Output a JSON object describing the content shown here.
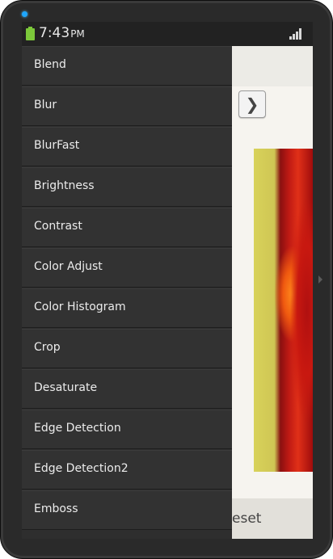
{
  "status_bar": {
    "time": "7:43",
    "ampm": "PM",
    "battery_icon": "battery-icon",
    "signal_icon": "signal-icon",
    "battery_color": "#7cc83a"
  },
  "drawer": {
    "items": [
      {
        "label": "Blend"
      },
      {
        "label": "Blur"
      },
      {
        "label": "BlurFast"
      },
      {
        "label": "Brightness"
      },
      {
        "label": "Contrast"
      },
      {
        "label": "Color Adjust"
      },
      {
        "label": "Color Histogram"
      },
      {
        "label": "Crop"
      },
      {
        "label": "Desaturate"
      },
      {
        "label": "Edge Detection"
      },
      {
        "label": "Edge Detection2"
      },
      {
        "label": "Emboss"
      }
    ]
  },
  "content": {
    "next_icon": "chevron-right-icon",
    "next_glyph": "❯",
    "reset_label": "eset"
  },
  "accent_color": "#1ea7ff"
}
